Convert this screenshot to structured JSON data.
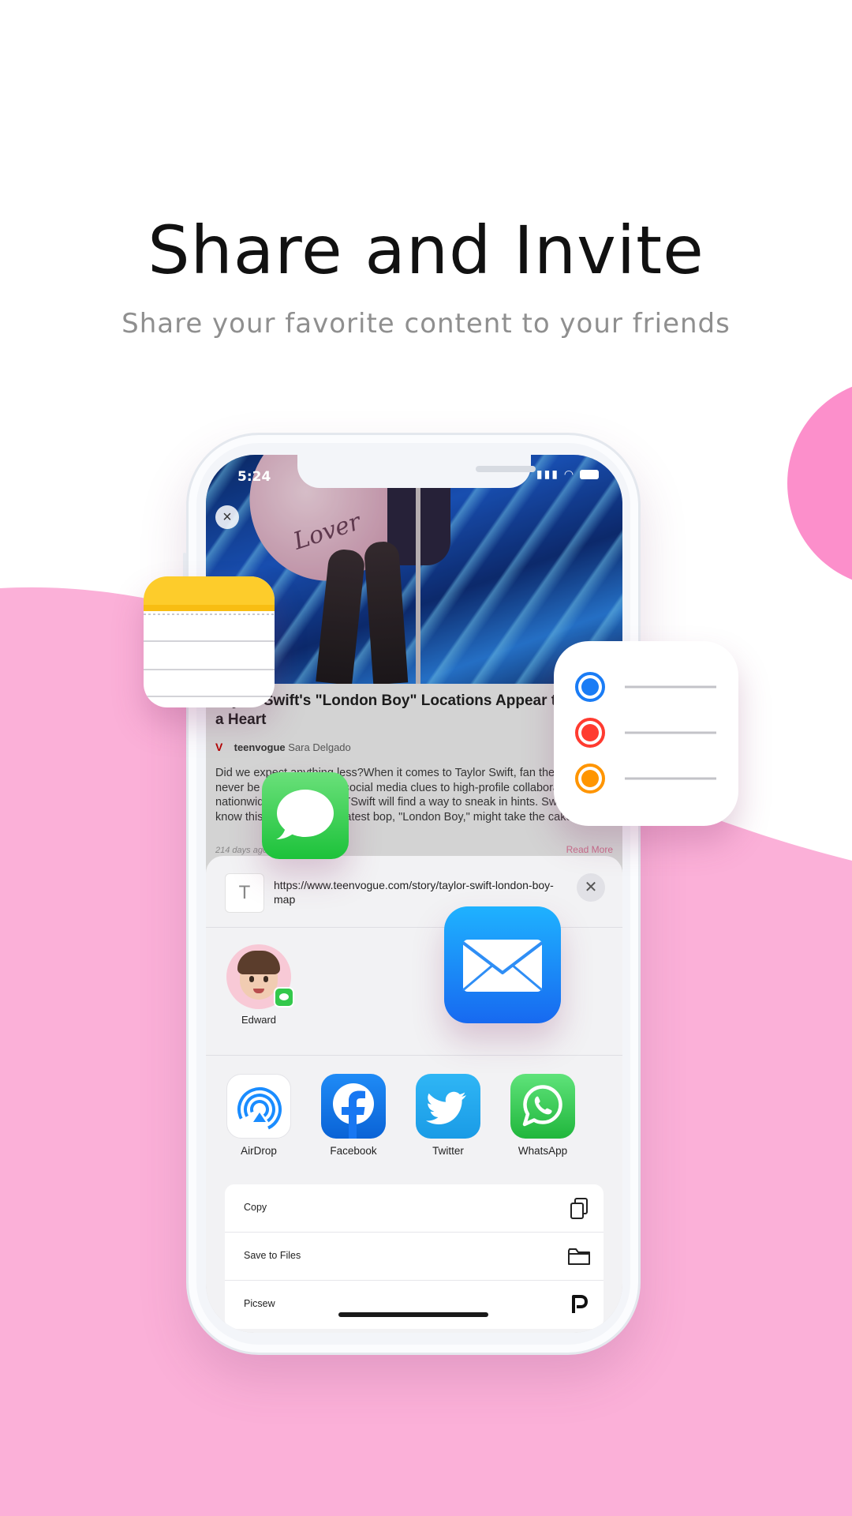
{
  "headline": "Share and Invite",
  "subline": "Share your favorite content to your friends",
  "colors": {
    "accent_pink": "#fbb0d8",
    "blob_pink": "#fc8fcb",
    "link_blue": "#1a8cff"
  },
  "status_bar": {
    "time": "5:24"
  },
  "hero": {
    "guitar_text": "Lover"
  },
  "article": {
    "title": "Taylor Swift's \"London Boy\" Locations Appear to Out a Heart",
    "source": "teenvogue",
    "author": "Sara Delgado",
    "body": "Did we expect anything less?When it comes to Taylor Swift, fan theories never be … From cryptic social media clues to high-profile collaborations and nationwide commercials, TSwift will find a way to sneak in hints. Swifties know this well — but her latest bop, \"London Boy,\" might take the cake.",
    "meta": "214 days ago",
    "read_more": "Read More"
  },
  "share_sheet": {
    "url": "https://www.teenvogue.com/story/taylor-swift-london-boy-map",
    "contact": {
      "name": "Edward"
    },
    "apps": [
      {
        "label": "AirDrop",
        "icon": "airdrop-icon"
      },
      {
        "label": "Facebook",
        "icon": "facebook-icon"
      },
      {
        "label": "Twitter",
        "icon": "twitter-icon"
      },
      {
        "label": "WhatsApp",
        "icon": "whatsapp-icon"
      }
    ],
    "actions": [
      {
        "label": "Copy",
        "icon": "copy-icon"
      },
      {
        "label": "Save to Files",
        "icon": "folder-icon"
      },
      {
        "label": "Picsew",
        "icon": "picsew-icon"
      }
    ]
  },
  "floating_icons": [
    "notes-icon",
    "reminders-icon",
    "messages-icon",
    "mail-icon"
  ]
}
